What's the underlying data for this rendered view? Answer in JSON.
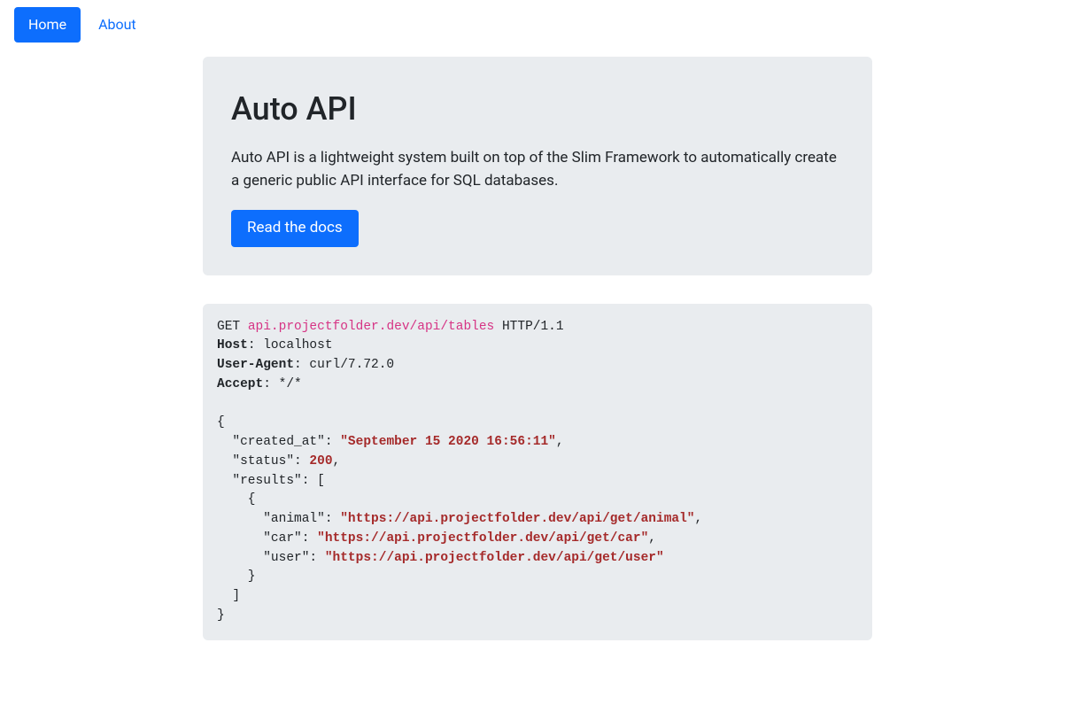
{
  "nav": {
    "home": "Home",
    "about": "About"
  },
  "jumbotron": {
    "title": "Auto API",
    "description": "Auto API is a lightweight system built on top of the Slim Framework to automatically create a generic public API interface for SQL databases.",
    "button": "Read the docs"
  },
  "code": {
    "method": "GET ",
    "url": "api.projectfolder.dev/api/tables",
    "protocol": " HTTP/1.1",
    "host_label": "Host",
    "host_value": ": localhost",
    "ua_label": "User-Agent",
    "ua_value": ": curl/7.72.0",
    "accept_label": "Accept",
    "accept_value": ": */*",
    "brace_open": "{",
    "created_key": "  \"created_at\": ",
    "created_val": "\"September 15 2020 16:56:11\"",
    "comma": ",",
    "status_key": "  \"status\": ",
    "status_val": "200",
    "results_key": "  \"results\": [",
    "inner_open": "    {",
    "animal_key": "      \"animal\": ",
    "animal_val": "\"https://api.projectfolder.dev/api/get/animal\"",
    "car_key": "      \"car\": ",
    "car_val": "\"https://api.projectfolder.dev/api/get/car\"",
    "user_key": "      \"user\": ",
    "user_val": "\"https://api.projectfolder.dev/api/get/user\"",
    "inner_close": "    }",
    "array_close": "  ]",
    "brace_close": "}"
  }
}
